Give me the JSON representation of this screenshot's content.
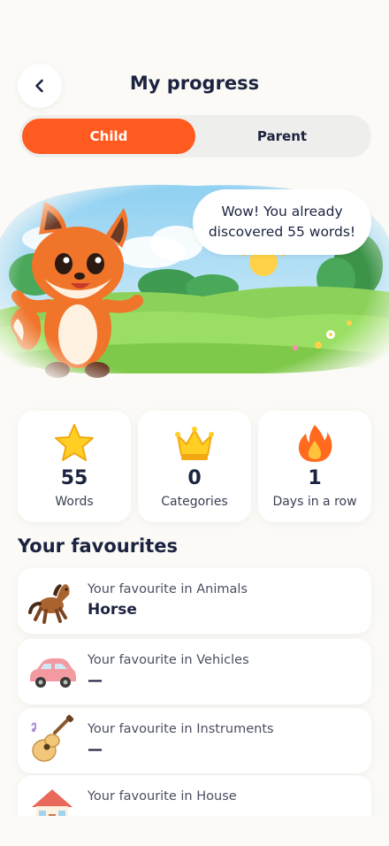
{
  "header": {
    "back_icon": "chevron-left-icon",
    "title": "My progress"
  },
  "toggle": {
    "options": [
      {
        "label": "Child",
        "active": true
      },
      {
        "label": "Parent",
        "active": false
      }
    ],
    "accent": "#ff5a1f"
  },
  "hero": {
    "speech": "Wow! You already discovered 55 words!"
  },
  "stats": [
    {
      "icon": "star-icon",
      "value": "55",
      "label": "Words"
    },
    {
      "icon": "crown-icon",
      "value": "0",
      "label": "Categories"
    },
    {
      "icon": "flame-icon",
      "value": "1",
      "label": "Days in a row"
    }
  ],
  "favourites": {
    "title": "Your favourites",
    "items": [
      {
        "icon": "horse-icon",
        "label": "Your favourite in Animals",
        "value": "Horse"
      },
      {
        "icon": "car-icon",
        "label": "Your favourite in Vehicles",
        "value": "—"
      },
      {
        "icon": "guitar-icon",
        "label": "Your favourite in Instruments",
        "value": "—"
      },
      {
        "icon": "house-icon",
        "label": "Your favourite in House",
        "value": "—"
      }
    ]
  }
}
